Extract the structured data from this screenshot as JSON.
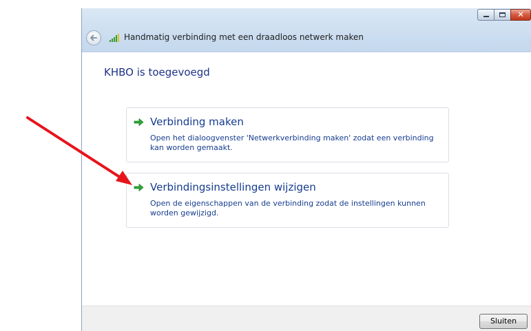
{
  "window": {
    "title": "Handmatig verbinding met een draadloos netwerk maken",
    "caption_buttons": [
      "minimize-icon",
      "maximize-icon",
      "close-icon"
    ],
    "close_glyph": "✕"
  },
  "main": {
    "heading": "KHBO is toegevoegd",
    "options": [
      {
        "title": "Verbinding maken",
        "description": "Open het dialoogvenster 'Netwerkverbinding maken' zodat een verbinding kan worden gemaakt.",
        "icon": "green-arrow-icon"
      },
      {
        "title": "Verbindingsinstellingen wijzigen",
        "description": "Open de eigenschappen van de verbinding zodat de instellingen kunnen worden gewijzigd.",
        "icon": "green-arrow-icon"
      }
    ]
  },
  "footer": {
    "close_label": "Sluiten"
  },
  "colors": {
    "link_blue": "#153c8f",
    "heading_blue": "#1e3287",
    "arrow_green": "#2fa83a",
    "annotation_red": "#e8141b"
  }
}
